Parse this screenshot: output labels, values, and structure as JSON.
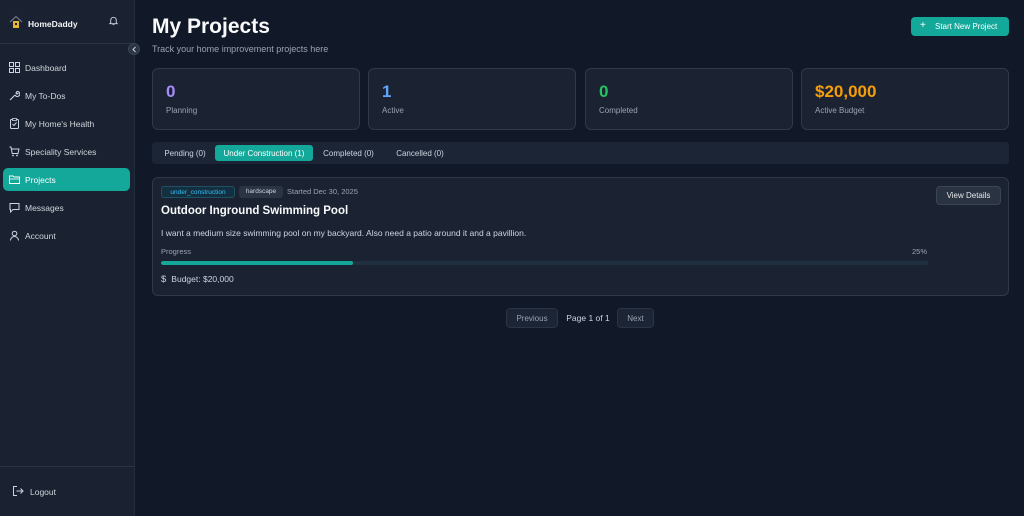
{
  "brand": {
    "name": "HomeDaddy"
  },
  "sidebar": {
    "items": [
      {
        "label": "Dashboard",
        "icon": "dashboard-icon"
      },
      {
        "label": "My To-Dos",
        "icon": "wrench-icon"
      },
      {
        "label": "My Home's Health",
        "icon": "clipboard-icon"
      },
      {
        "label": "Speciality Services",
        "icon": "cart-icon"
      },
      {
        "label": "Projects",
        "icon": "folder-icon",
        "active": true
      },
      {
        "label": "Messages",
        "icon": "message-icon"
      },
      {
        "label": "Account",
        "icon": "user-icon"
      }
    ],
    "logout_label": "Logout"
  },
  "header": {
    "title": "My Projects",
    "subtitle": "Track your home improvement projects here",
    "new_button_label": "Start New Project"
  },
  "stats": [
    {
      "value": "0",
      "label": "Planning",
      "color": "#a78bfa"
    },
    {
      "value": "1",
      "label": "Active",
      "color": "#60a5fa"
    },
    {
      "value": "0",
      "label": "Completed",
      "color": "#22c55e"
    },
    {
      "value": "$20,000",
      "label": "Active Budget",
      "color": "#f59e0b"
    }
  ],
  "tabs": [
    {
      "label": "Pending (0)"
    },
    {
      "label": "Under Construction (1)",
      "active": true
    },
    {
      "label": "Completed (0)"
    },
    {
      "label": "Cancelled (0)"
    }
  ],
  "project": {
    "status_badge": "under_construction",
    "category_badge": "hardscape",
    "started": "Started Dec 30, 2025",
    "view_label": "View Details",
    "title": "Outdoor Inground Swimming Pool",
    "description": "I want a medium size swimming pool on my backyard. Also need a patio around it and a pavillion.",
    "progress_label": "Progress",
    "progress_pct": 25,
    "progress_text": "25%",
    "budget_text": "Budget: $20,000"
  },
  "pagination": {
    "prev_label": "Previous",
    "info": "Page 1 of 1",
    "next_label": "Next"
  },
  "colors": {
    "accent": "#14a89a",
    "background": "#111827",
    "sidebar": "#1a2231"
  }
}
